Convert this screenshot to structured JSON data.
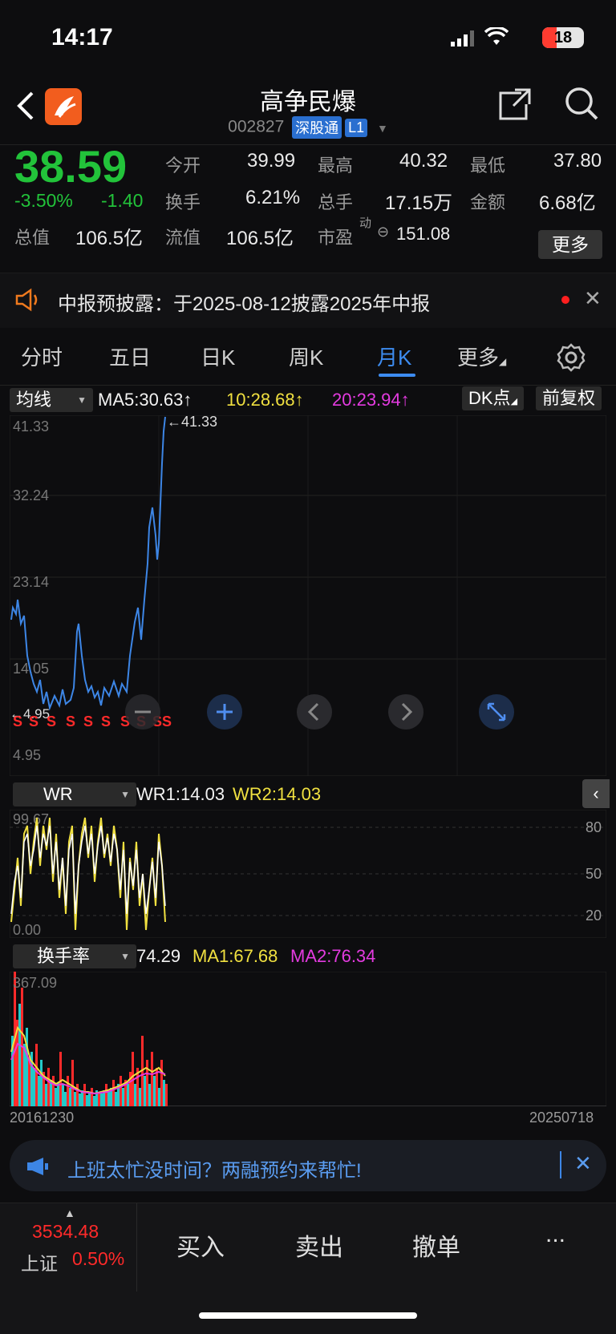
{
  "status_bar": {
    "time": "14:17",
    "battery": "18"
  },
  "header": {
    "title": "高争民爆",
    "code": "002827",
    "tag1": "深股通",
    "tag2": "L1"
  },
  "quote": {
    "price": "38.59",
    "change_pct": "-3.50%",
    "change": "-1.40",
    "open_label": "今开",
    "open": "39.99",
    "high_label": "最高",
    "high": "40.32",
    "low_label": "最低",
    "low": "37.80",
    "turnover_label": "换手",
    "turnover": "6.21%",
    "volume_label": "总手",
    "volume": "17.15万",
    "amount_label": "金额",
    "amount": "6.68亿",
    "total_mv_label": "总值",
    "total_mv": "106.5亿",
    "float_mv_label": "流值",
    "float_mv": "106.5亿",
    "pe_label": "市盈",
    "pe_sup": "动",
    "pe": "151.08",
    "more": "更多"
  },
  "notice": {
    "text": "中报预披露：于2025-08-12披露2025年中报"
  },
  "tabs": [
    "分时",
    "五日",
    "日K",
    "周K",
    "月K",
    "更多"
  ],
  "ma_row": {
    "selector": "均线",
    "ma5": "MA5:30.63↑",
    "ma10": "10:28.68↑",
    "ma20": "20:23.94↑",
    "dk": "DK点",
    "fq": "前复权"
  },
  "main_chart": {
    "y_ticks": [
      "41.33",
      "32.24",
      "23.14",
      "14.05",
      "4.95"
    ],
    "max_label": "←41.33",
    "min_label": "←4.95",
    "s_marks": [
      "S",
      "S",
      "S",
      "S",
      "S",
      "S",
      "S",
      "S",
      "S",
      "S"
    ]
  },
  "wr_row": {
    "selector": "WR",
    "wr1": "WR1:14.03",
    "wr2": "WR2:14.03",
    "top": "99.67",
    "bottom": "0.00",
    "levels": [
      "80",
      "50",
      "20"
    ]
  },
  "turn_row": {
    "selector": "换手率",
    "value": "74.29",
    "ma1": "MA1:67.68",
    "ma2": "MA2:76.34",
    "top": "367.09",
    "start_date": "20161230",
    "end_date": "20250718"
  },
  "banner": {
    "text": "上班太忙没时间？两融预约来帮忙!"
  },
  "bottom_bar": {
    "index_value": "3534.48",
    "index_name": "上证",
    "index_pct": "0.50%",
    "buy": "买入",
    "sell": "卖出",
    "cancel": "撤单",
    "more": "..."
  },
  "colors": {
    "up": "#ff2a2a",
    "down": "#22c33a",
    "line": "#3d86e6",
    "ma1": "#f0e040",
    "ma2": "#e43be0",
    "accent": "#2a7de1"
  }
}
